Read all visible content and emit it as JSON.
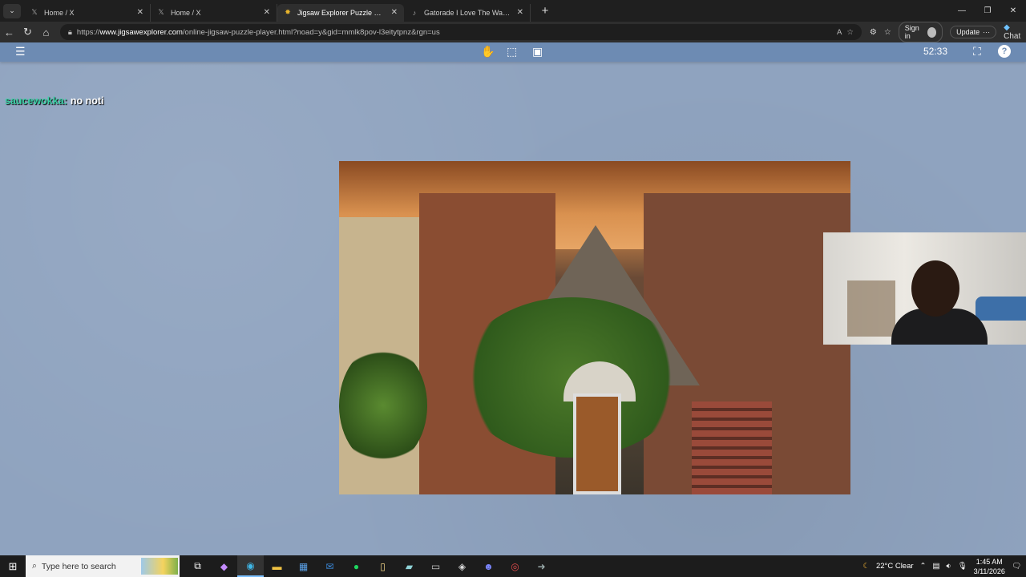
{
  "browser": {
    "tabs": [
      {
        "label": "Home / X",
        "icon": "x-logo-icon",
        "active": false
      },
      {
        "label": "Home / X",
        "icon": "x-logo-icon",
        "active": false
      },
      {
        "label": "Jigsaw Explorer Puzzle Player",
        "icon": "jigsaw-icon",
        "active": true
      },
      {
        "label": "Gatorade I Love The Way It Tastes",
        "icon": "tiktok-icon",
        "active": false
      }
    ],
    "url_prefix": "https://",
    "url_domain": "www.jigsawexplorer.com",
    "url_path": "/online-jigsaw-puzzle-player.html?noad=y&gid=mmlk8pov-l3eitytpnz&rgn=us",
    "sign_in": "Sign in",
    "update": "Update",
    "chat": "Chat"
  },
  "puzzle_app": {
    "timer": "52:33",
    "tools": [
      "hand-tool-icon",
      "select-box-icon",
      "image-preview-icon"
    ]
  },
  "chat_overlay": {
    "user": "saucewokka:",
    "message": "no noti"
  },
  "taskbar": {
    "search_placeholder": "Type here to search",
    "weather": "22°C  Clear",
    "time": "1:45 AM",
    "date": "3/11/2026"
  }
}
